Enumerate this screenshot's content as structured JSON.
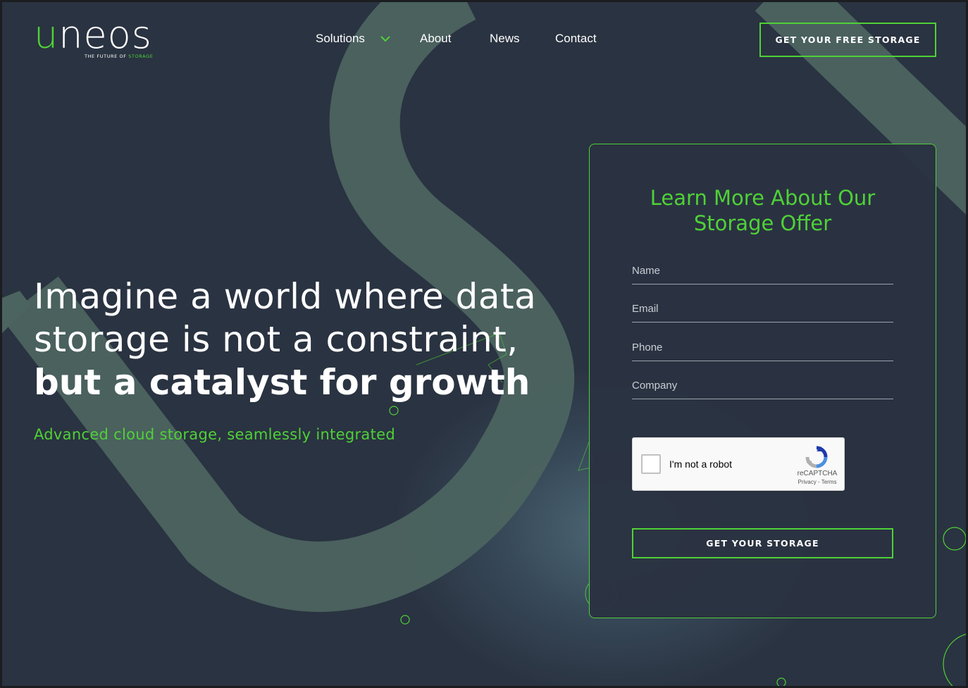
{
  "brand": {
    "logo_first": "u",
    "logo_rest": "neos",
    "tagline_prefix": "THE FUTURE OF ",
    "tagline_highlight": "STORAGE"
  },
  "nav": {
    "items": [
      "Solutions",
      "About",
      "News",
      "Contact"
    ],
    "solutions_has_dropdown": true
  },
  "header_cta": "GET YOUR FREE STORAGE",
  "hero": {
    "line1": "Imagine a world where data",
    "line2": "storage is not a constraint,",
    "line3": "but a catalyst for growth",
    "subtitle": "Advanced cloud storage, seamlessly integrated"
  },
  "form": {
    "title_line1": "Learn More About Our",
    "title_line2": "Storage Offer",
    "fields": [
      {
        "label": "Name"
      },
      {
        "label": "Email"
      },
      {
        "label": "Phone"
      },
      {
        "label": "Company"
      }
    ],
    "recaptcha": {
      "label": "I'm not a robot",
      "brand": "reCAPTCHA",
      "links": "Privacy - Terms"
    },
    "submit": "GET YOUR STORAGE"
  },
  "colors": {
    "accent": "#4fd137",
    "background": "#2a3341",
    "ribbon": "#4c6460",
    "text": "#ffffff"
  },
  "icons": {
    "solutions_dropdown": "chevron-down-icon",
    "recaptcha": "recaptcha-logo-icon"
  }
}
